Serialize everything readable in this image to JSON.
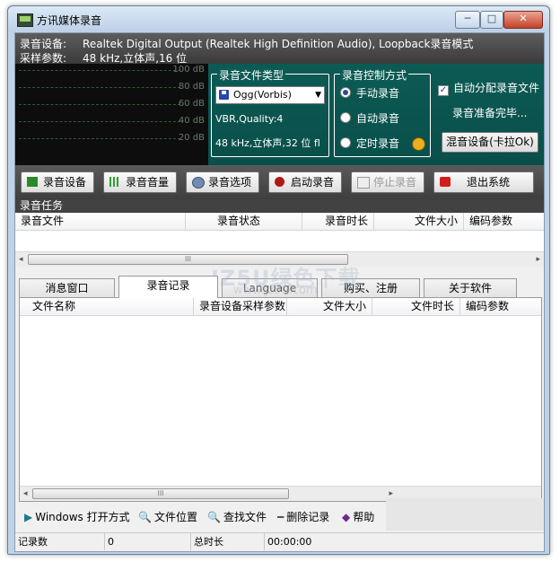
{
  "window": {
    "title": "方讯媒体录音",
    "minimize_glyph": "─",
    "maximize_glyph": "□",
    "close_glyph": "✕"
  },
  "info": {
    "device_label": "录音设备:",
    "device_value": "Realtek Digital Output (Realtek High Definition Audio), Loopback录音模式",
    "sample_label": "采样参数:",
    "sample_value": "48   kHz,立体声,16 位"
  },
  "meter": {
    "levels": [
      "100 dB",
      "80 dB",
      "60 dB",
      "40 dB",
      "20 dB"
    ]
  },
  "file_type": {
    "title": "录音文件类型",
    "format_value": "Ogg(Vorbis)",
    "quality_text": "VBR,Quality:4",
    "format_text": "48   kHz,立体声,32 位 fl"
  },
  "control": {
    "title": "录音控制方式",
    "options": [
      "手动录音",
      "自动录音",
      "定时录音"
    ],
    "selected": "手动录音"
  },
  "auto_split": {
    "label": "自动分配录音文件",
    "checked": true,
    "check_glyph": "✓"
  },
  "status_text": "录音准备完毕...",
  "mix_button_label": "混音设备(卡拉Ok)",
  "toolbar": {
    "device": "录音设备",
    "volume": "录音音量",
    "options": "录音选项",
    "start": "启动录音",
    "stop": "停止录音",
    "exit": "退出系统"
  },
  "tasks": {
    "title": "录音任务",
    "columns": [
      "录音文件",
      "录音状态",
      "录音时长",
      "文件大小",
      "编码参数"
    ],
    "rows": []
  },
  "scroll": {
    "left_arrow": "◂",
    "right_arrow": "▸",
    "thumb_grip": "III"
  },
  "tabs": [
    "消息窗口",
    "录音记录",
    "Language",
    "购买、注册",
    "关于软件"
  ],
  "active_tab": "录音记录",
  "records": {
    "columns": [
      "文件名称",
      "录音设备采样参数",
      "文件大小",
      "文件时长",
      "编码参数"
    ],
    "rows": []
  },
  "bottom_toolbar": {
    "open_with": "Windows 打开方式",
    "location": "文件位置",
    "find": "查找文件",
    "delete": "删除记录",
    "help": "帮助",
    "icons": {
      "open_with": "▶",
      "location": "🔍",
      "find": "🔍",
      "delete": "━",
      "help": "◆"
    }
  },
  "statusbar": {
    "count_label": "记录数",
    "count_value": "0",
    "duration_label": "总时长",
    "duration_value": "00:00:00"
  },
  "watermark": {
    "text": "JZ5U绿色下载",
    "url": "www.jz5u.com"
  },
  "colors": {
    "teal_panel": "#0c5a54",
    "dark_panel": "#3e3e3e",
    "meter_bg": "#0d0d0d"
  }
}
